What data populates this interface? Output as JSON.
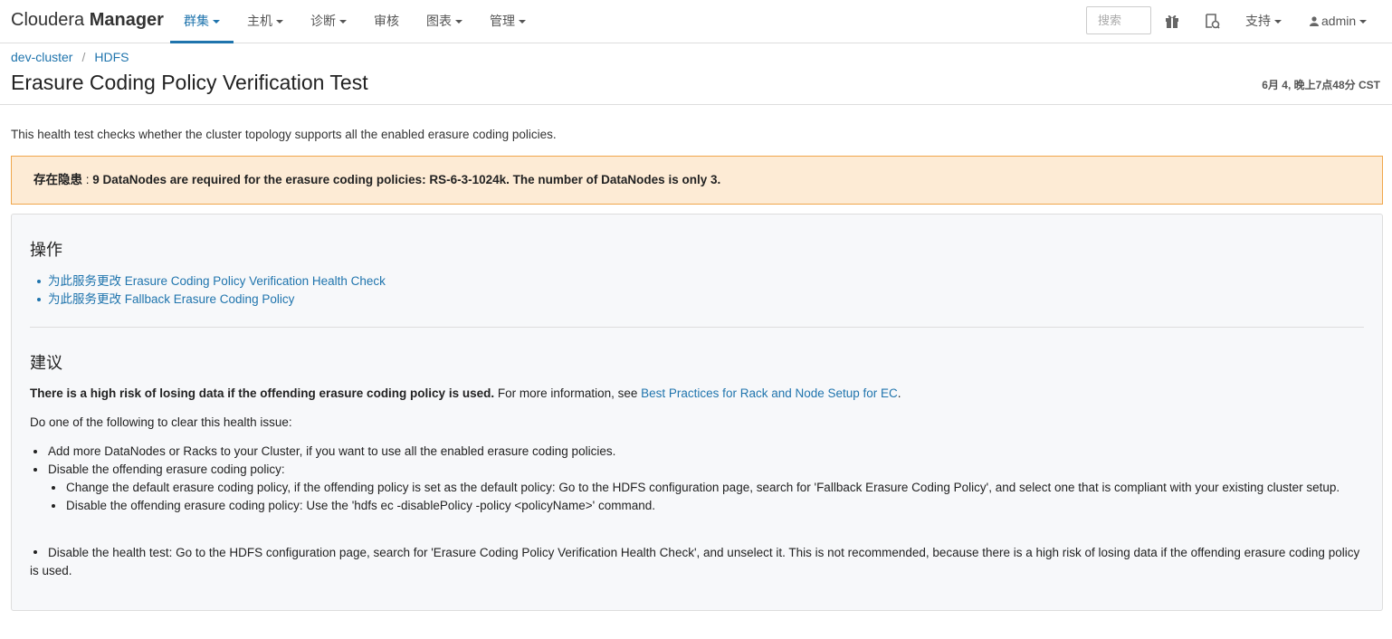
{
  "brand": {
    "part1": "Cloudera ",
    "part2": "Manager"
  },
  "nav": {
    "items": [
      {
        "label": "群集",
        "active": true
      },
      {
        "label": "主机",
        "active": false
      },
      {
        "label": "诊断",
        "active": false
      },
      {
        "label": "审核",
        "active": false
      },
      {
        "label": "图表",
        "active": false
      },
      {
        "label": "管理",
        "active": false
      }
    ],
    "search_placeholder": "搜索",
    "support_label": "支持",
    "user_label": "admin"
  },
  "breadcrumb": {
    "cluster": "dev-cluster",
    "separator": "/",
    "service": "HDFS"
  },
  "page": {
    "title": "Erasure Coding Policy Verification Test",
    "timestamp": "6月 4, 晚上7点48分 CST",
    "description": "This health test checks whether the cluster topology supports all the enabled erasure coding policies."
  },
  "alert": {
    "prefix": "存在隐患",
    "colon": " : ",
    "message": "9 DataNodes are required for the erasure coding policies: RS-6-3-1024k. The number of DataNodes is only 3."
  },
  "actions": {
    "heading": "操作",
    "links": [
      "为此服务更改 Erasure Coding Policy Verification Health Check",
      "为此服务更改 Fallback Erasure Coding Policy"
    ]
  },
  "recommendation": {
    "heading": "建议",
    "risk_bold": "There is a high risk of losing data if the offending erasure coding policy is used.",
    "more_info": " For more information, see ",
    "link": "Best Practices for Rack and Node Setup for EC",
    "period": ".",
    "intro": "Do one of the following to clear this health issue:",
    "items": [
      "Add more DataNodes or Racks to your Cluster, if you want to use all the enabled erasure coding policies.",
      "Disable the offending erasure coding policy:"
    ],
    "subitems": [
      "Change the default erasure coding policy, if the offending policy is set as the default policy: Go to the HDFS configuration page, search for 'Fallback Erasure Coding Policy', and select one that is compliant with your existing cluster setup.",
      "Disable the offending erasure coding policy: Use the 'hdfs ec -disablePolicy -policy <policyName>' command."
    ],
    "last_item": "Disable the health test: Go to the HDFS configuration page, search for 'Erasure Coding Policy Verification Health Check', and unselect it. This is not recommended, because there is a high risk of losing data if the offending erasure coding policy is used."
  },
  "colors": {
    "accent": "#1f74ad",
    "alert_bg": "#fdebd5",
    "alert_border": "#f0a64b"
  }
}
